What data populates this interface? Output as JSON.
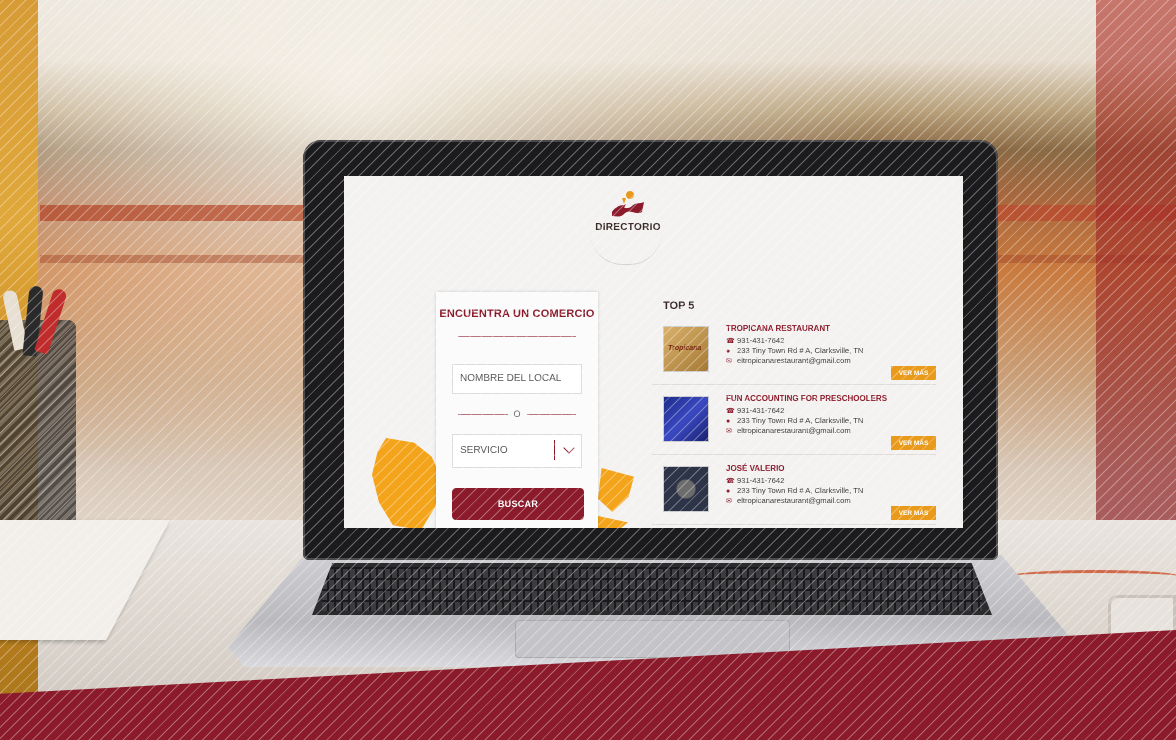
{
  "logo": {
    "text": "DIRECTORIO"
  },
  "search": {
    "title": "ENCUENTRA UN COMERCIO",
    "name_placeholder": "NOMBRE DEL LOCAL",
    "or_label": "O",
    "service_label": "SERVICIO",
    "button_label": "BUSCAR"
  },
  "top": {
    "title": "TOP 5",
    "items": [
      {
        "name": "TROPICANA RESTAURANT",
        "phone": "931-431-7642",
        "address": "233 Tiny Town Rd # A, Clarksville, TN",
        "email": "eltropicanarestaurant@gmail.com",
        "thumb_text": "Tropicana",
        "button": "VER MÁS"
      },
      {
        "name": "FUN ACCOUNTING FOR PRESCHOOLERS",
        "phone": "931-431-7642",
        "address": "233 Tiny Town Rd # A, Clarksville, TN",
        "email": "eltropicanarestaurant@gmail.com",
        "thumb_text": "",
        "button": "VER MÁS"
      },
      {
        "name": "JOSÉ VALERIO",
        "phone": "931-431-7642",
        "address": "233 Tiny Town Rd # A, Clarksville, TN",
        "email": "eltropicanarestaurant@gmail.com",
        "thumb_text": "",
        "button": "VER MÁS"
      }
    ]
  },
  "colors": {
    "brand": "#8b1a2b",
    "accent": "#e99a1a",
    "map": "#f4a41a"
  },
  "icons": {
    "phone": "phone-icon",
    "location": "location-pin-icon",
    "email": "email-icon",
    "select": "chevron-down-icon"
  }
}
